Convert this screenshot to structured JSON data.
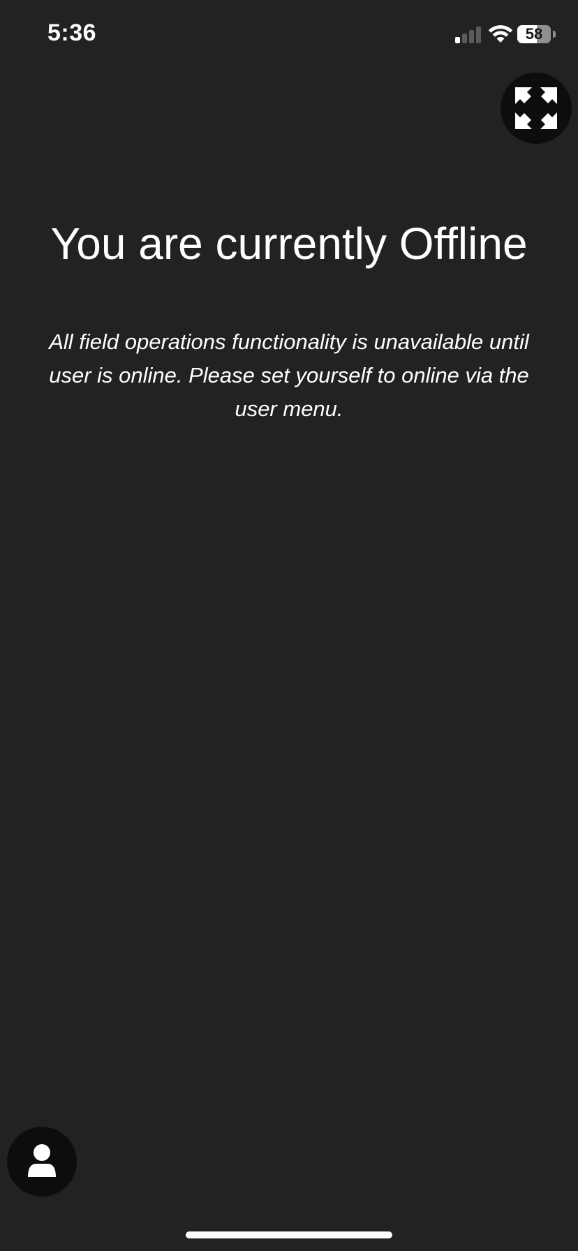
{
  "status_bar": {
    "time": "5:36",
    "battery_percent": "58",
    "signal_bars_active": 1,
    "signal_bars_total": 4,
    "icons": [
      "signal-icon",
      "wifi-icon",
      "battery-icon"
    ]
  },
  "toolbar": {
    "expand_icon": "expand-arrows-icon"
  },
  "main": {
    "title": "You are currently Offline",
    "message": "All field operations functionality is unavailable until user is online. Please set yourself to online via the user menu."
  },
  "user_menu": {
    "icon": "user-icon"
  },
  "colors": {
    "background": "#222222",
    "button_background": "#0d0d0d",
    "text": "#ffffff"
  }
}
